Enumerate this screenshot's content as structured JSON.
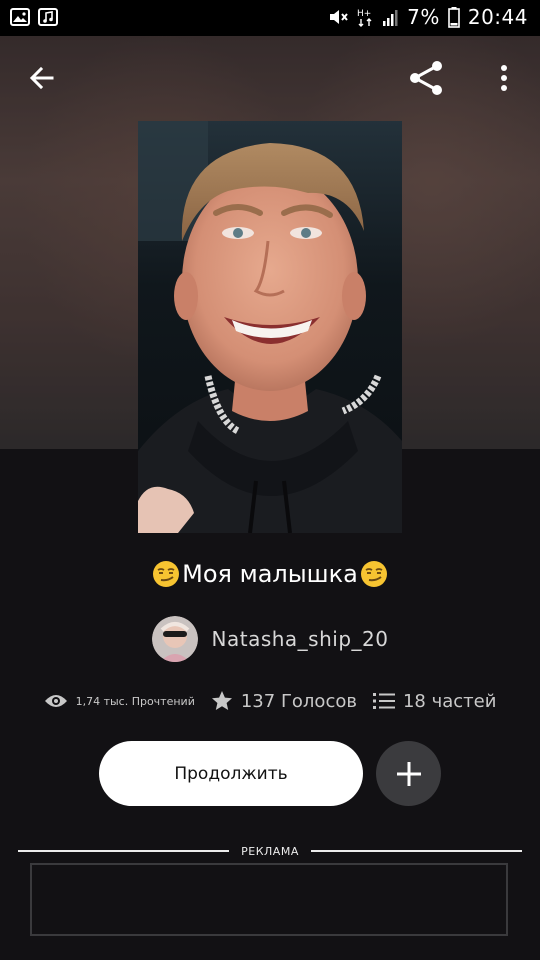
{
  "status_bar": {
    "battery": "7%",
    "time": "20:44",
    "left_icons": [
      "gallery-icon",
      "music-icon"
    ],
    "right_icons": [
      "mute-icon",
      "signal-hplus-icon",
      "signal-bars-icon",
      "battery-icon"
    ]
  },
  "top_bar": {
    "icons": [
      "back-arrow-icon",
      "share-icon",
      "more-vert-icon"
    ]
  },
  "story": {
    "title": "Моя малышка",
    "title_emoji": "smirk-emoji",
    "author": "Natasha_ship_20",
    "stats": {
      "reads": "1,74 тыс. Прочтений",
      "votes": "137 Голосов",
      "parts": "18 частей"
    }
  },
  "actions": {
    "continue_label": "Продолжить",
    "add_icon": "plus-icon"
  },
  "ad": {
    "label": "РЕКЛАМА"
  },
  "colors": {
    "background": "#121114",
    "button_primary": "#ffffff",
    "button_secondary": "#3b3b3e",
    "text_secondary": "#c8c8c8"
  }
}
